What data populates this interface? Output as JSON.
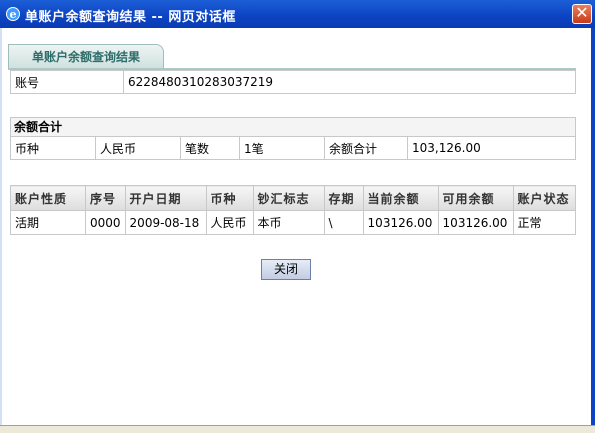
{
  "window": {
    "title": "单账户余额查询结果 -- 网页对话框",
    "close_glyph": "✕"
  },
  "tab": {
    "label": "单账户余额查询结果"
  },
  "account": {
    "label": "账号",
    "value": "6228480310283037219"
  },
  "summary": {
    "heading": "余额合计",
    "currency_label": "币种",
    "currency_value": "人民币",
    "count_label": "笔数",
    "count_value": "1笔",
    "total_label": "余额合计",
    "total_value": "103,126.00"
  },
  "details": {
    "headers": [
      "账户性质",
      "序号",
      "开户日期",
      "币种",
      "钞汇标志",
      "存期",
      "当前余额",
      "可用余额",
      "账户状态"
    ],
    "rows": [
      [
        "活期",
        "0000",
        "2009-08-18",
        "人民币",
        "本币",
        "\\",
        "103126.00",
        "103126.00",
        "正常"
      ]
    ]
  },
  "buttons": {
    "close_label": "关闭"
  },
  "colors": {
    "titlebar": "#0d44c4",
    "tab_text": "#2d6d6a"
  }
}
